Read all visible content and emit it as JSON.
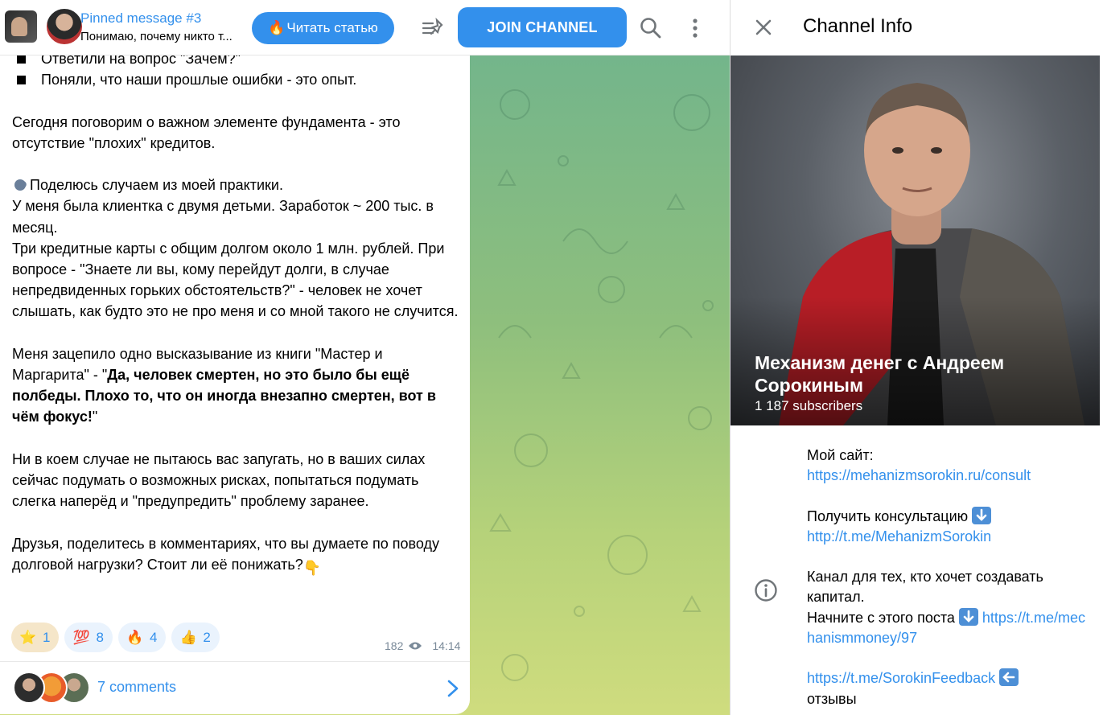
{
  "topbar": {
    "pinned_title": "Pinned message #3",
    "pinned_text": "Понимаю, почему никто т...",
    "read_button": "Читать статью",
    "join_button": "JOIN CHANNEL",
    "icons": [
      "pinned-list-icon",
      "search-icon",
      "more-vertical-icon"
    ]
  },
  "message": {
    "bullet_1": "Ответили на вопрос \"Зачем?\"",
    "bullet_2": "Поняли, что наши прошлые ошибки - это опыт.",
    "p1": "Сегодня поговорим о важном элементе фундамента - это отсутствие \"плохих\" кредитов.",
    "p2_line1": "Поделюсь случаем из моей практики.",
    "p2_line2": "У меня была клиентка с двумя детьми. Заработок ~ 200 тыс. в месяц.",
    "p2_line3": "Три кредитные карты с общим долгом около 1 млн. рублей. При вопросе - \"Знаете ли вы, кому перейдут долги, в случае непредвиденных горьких обстоятельств?\" - человек не хочет слышать, как будто это не про меня и со мной такого не случится.",
    "p3_start": "Меня зацепило одно высказывание из книги \"Мастер и Маргарита\" - \"",
    "p3_bold": "Да, человек смертен, но это было бы ещё полбеды. Плохо то, что он иногда внезапно смертен, вот в чём фокус!",
    "p3_end": "\"",
    "p4": "Ни в коем случае не пытаюсь вас запугать, но в ваших силах сейчас подумать о возможных рисках, попытаться подумать слегка наперёд и \"предупредить\" проблему заранее.",
    "p5": "Друзья, поделитесь в комментариях, что вы думаете по поводу долговой нагрузки? Стоит ли её понижать?",
    "reactions": [
      {
        "emoji": "⭐",
        "count": "1"
      },
      {
        "emoji": "💯",
        "count": "8"
      },
      {
        "emoji": "🔥",
        "count": "4"
      },
      {
        "emoji": "👍",
        "count": "2"
      }
    ],
    "views": "182",
    "time": "14:14",
    "comments": "7 comments"
  },
  "info": {
    "title": "Channel Info",
    "channel_name": "Механизм денег с Андреем Сорокиным",
    "subscribers": "1 187 subscribers",
    "site_label": "Мой сайт:",
    "site_link": "https://mehanizmsorokin.ru/consult",
    "consult_label": "Получить консультацию",
    "consult_link": "http://t.me/MehanizmSorokin",
    "about_1": "Канал для тех, кто хочет создавать капитал.",
    "about_2": "Начните с этого поста",
    "about_link": "https://t.me/mechanismmoney/97",
    "feedback_link": "https://t.me/SorokinFeedback",
    "feedback_label": "отзывы"
  }
}
